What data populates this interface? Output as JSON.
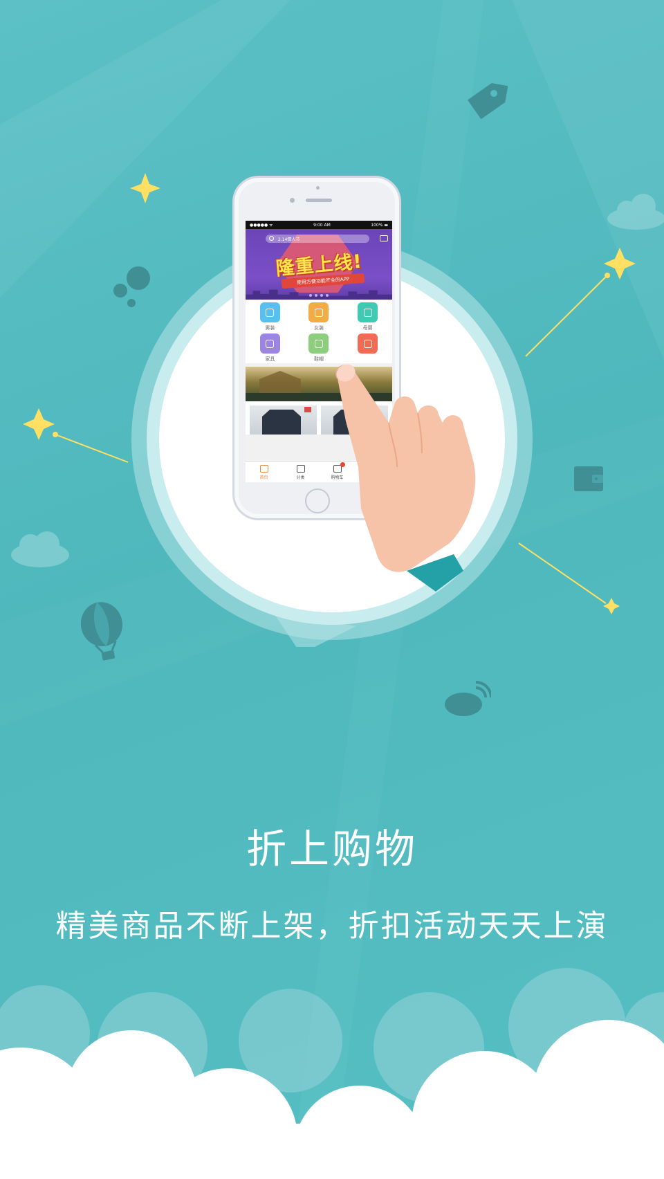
{
  "colors": {
    "background": "#52bcc1",
    "accent_star": "#ffe063",
    "tab_active": "#f08a3c",
    "banner_purple": "#7b4fc6"
  },
  "phone": {
    "status_bar": {
      "signal": "●●●●● ᯤ",
      "time": "9:00 AM",
      "battery": "100% ▬"
    },
    "search_placeholder": "2.14情人节",
    "banner": {
      "headline": "隆重上线!",
      "ribbon": "使用方便功能齐全的APP"
    },
    "categories": [
      {
        "label": "男装",
        "icon": "shirt-icon",
        "color": "#58c0ee"
      },
      {
        "label": "女装",
        "icon": "dress-icon",
        "color": "#f2ac45"
      },
      {
        "label": "母婴",
        "icon": "bottle-icon",
        "color": "#3fcab4"
      },
      {
        "label": "家具",
        "icon": "printer-icon",
        "color": "#9a86e0"
      },
      {
        "label": "鞋帽",
        "icon": "boot-icon",
        "color": "#8cce7c"
      },
      {
        "label": "",
        "icon": "tv-icon",
        "color": "#f16a54"
      }
    ],
    "tabbar": [
      {
        "label": "首页",
        "icon": "store-icon",
        "active": true
      },
      {
        "label": "分类",
        "icon": "category-icon",
        "active": false
      },
      {
        "label": "购物车",
        "icon": "cart-icon",
        "active": false
      }
    ]
  },
  "decor_icons": [
    "tag-icon",
    "wallet-icon",
    "balloon-icon",
    "weibo-icon",
    "star-icon",
    "cloud-icon"
  ],
  "title": "折上购物",
  "subtitle": "精美商品不断上架，折扣活动天天上演"
}
